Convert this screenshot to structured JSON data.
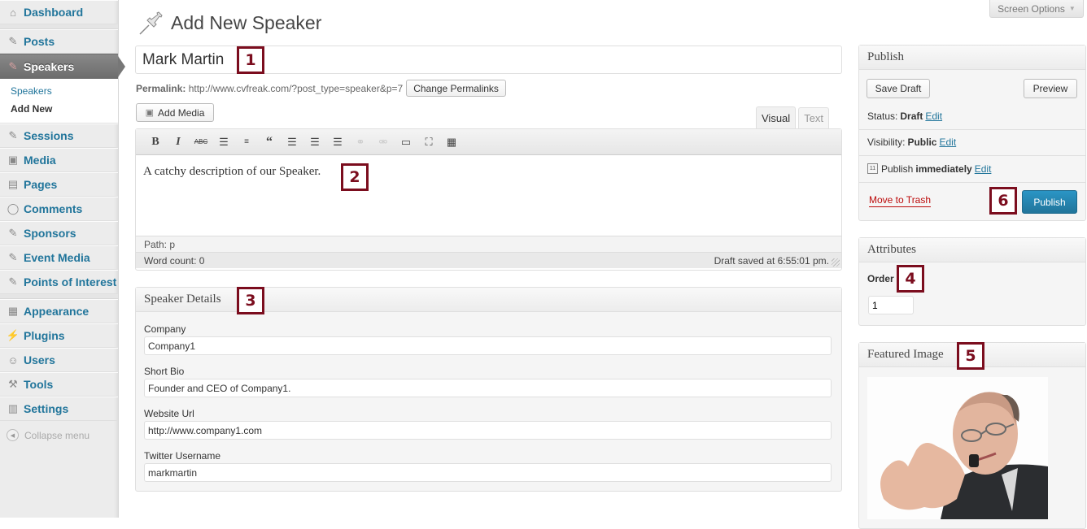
{
  "sidebar": {
    "items": [
      {
        "label": "Dashboard",
        "icon": "dashboard-icon"
      },
      {
        "label": "Posts",
        "icon": "pushpin-icon"
      },
      {
        "label": "Speakers",
        "icon": "pushpin-icon",
        "active": true
      },
      {
        "label": "Sessions",
        "icon": "pushpin-icon"
      },
      {
        "label": "Media",
        "icon": "media-icon"
      },
      {
        "label": "Pages",
        "icon": "pages-icon"
      },
      {
        "label": "Comments",
        "icon": "comment-icon"
      },
      {
        "label": "Sponsors",
        "icon": "pushpin-icon"
      },
      {
        "label": "Event Media",
        "icon": "pushpin-icon"
      },
      {
        "label": "Points of Interest",
        "icon": "pushpin-icon"
      },
      {
        "label": "Appearance",
        "icon": "appearance-icon"
      },
      {
        "label": "Plugins",
        "icon": "plugin-icon"
      },
      {
        "label": "Users",
        "icon": "users-icon"
      },
      {
        "label": "Tools",
        "icon": "tools-icon"
      },
      {
        "label": "Settings",
        "icon": "settings-icon"
      }
    ],
    "submenu": {
      "all": "Speakers",
      "add_new": "Add New"
    },
    "collapse_label": "Collapse menu"
  },
  "header": {
    "screen_options": "Screen Options",
    "page_title": "Add New Speaker"
  },
  "post": {
    "title": "Mark Martin",
    "permalink_label": "Permalink:",
    "permalink_url": "http://www.cvfreak.com/?post_type=speaker&p=7",
    "change_permalinks": "Change Permalinks",
    "add_media": "Add Media"
  },
  "editor": {
    "tabs": {
      "visual": "Visual",
      "text": "Text"
    },
    "toolbar": [
      "bold",
      "italic",
      "strikethrough",
      "bullet-list",
      "numbered-list",
      "blockquote",
      "align-left",
      "align-center",
      "align-right",
      "insert-link",
      "remove-link",
      "insert-more",
      "fullscreen",
      "kitchen-sink"
    ],
    "content": "A catchy description of our Speaker.",
    "path": "Path: p",
    "word_count": "Word count: 0",
    "draft_saved": "Draft saved at 6:55:01 pm."
  },
  "speaker_details": {
    "title": "Speaker Details",
    "fields": [
      {
        "label": "Company",
        "value": "Company1"
      },
      {
        "label": "Short Bio",
        "value": "Founder and CEO of Company1."
      },
      {
        "label": "Website Url",
        "value": "http://www.company1.com"
      },
      {
        "label": "Twitter Username",
        "value": "markmartin"
      }
    ]
  },
  "publish": {
    "title": "Publish",
    "save_draft": "Save Draft",
    "preview": "Preview",
    "status_label": "Status:",
    "status_value": "Draft",
    "visibility_label": "Visibility:",
    "visibility_value": "Public",
    "publish_label": "Publish",
    "publish_value": "immediately",
    "edit": "Edit",
    "move_to_trash": "Move to Trash",
    "publish_button": "Publish"
  },
  "attributes": {
    "title": "Attributes",
    "order_label": "Order",
    "order_value": "1"
  },
  "featured_image": {
    "title": "Featured Image",
    "alt": "Speaker photo: man with glasses speaking into a microphone"
  },
  "annotations": [
    "1",
    "2",
    "3",
    "4",
    "5",
    "6"
  ],
  "colors": {
    "link": "#21759b",
    "annotation": "#7b0d1e",
    "publish_button": "#2a95c5",
    "trash": "#bc0b0b"
  }
}
